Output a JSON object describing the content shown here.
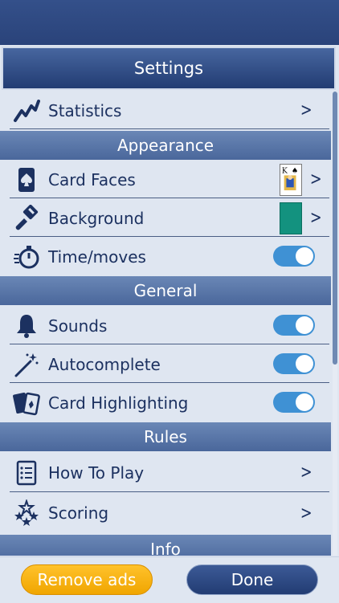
{
  "header": {
    "title": "Settings"
  },
  "rows": {
    "statistics": {
      "label": "Statistics",
      "icon": "trend-chart-icon"
    },
    "card_faces": {
      "label": "Card Faces",
      "icon": "spade-card-icon"
    },
    "background": {
      "label": "Background",
      "icon": "paint-brush-icon"
    },
    "time_moves": {
      "label": "Time/moves",
      "icon": "stopwatch-icon",
      "toggle": true
    },
    "sounds": {
      "label": "Sounds",
      "icon": "bell-icon",
      "toggle": true
    },
    "autocomplete": {
      "label": "Autocomplete",
      "icon": "magic-wand-icon",
      "toggle": true
    },
    "card_highlighting": {
      "label": "Card Highlighting",
      "icon": "cards-icon",
      "toggle": true
    },
    "how_to_play": {
      "label": "How To Play",
      "icon": "list-icon"
    },
    "scoring": {
      "label": "Scoring",
      "icon": "stars-icon"
    }
  },
  "sections": {
    "appearance": "Appearance",
    "general": "General",
    "rules": "Rules",
    "info": "Info"
  },
  "card_face_preview": {
    "rank": "K",
    "suit": "♠"
  },
  "buttons": {
    "remove_ads": "Remove ads",
    "done": "Done"
  },
  "colors": {
    "accent_toggle": "#3f91d4",
    "header_blue": "#223c73",
    "section_blue": "#5a77a9",
    "remove_ads_orange": "#f0a500",
    "background_preview": "#13927f"
  }
}
